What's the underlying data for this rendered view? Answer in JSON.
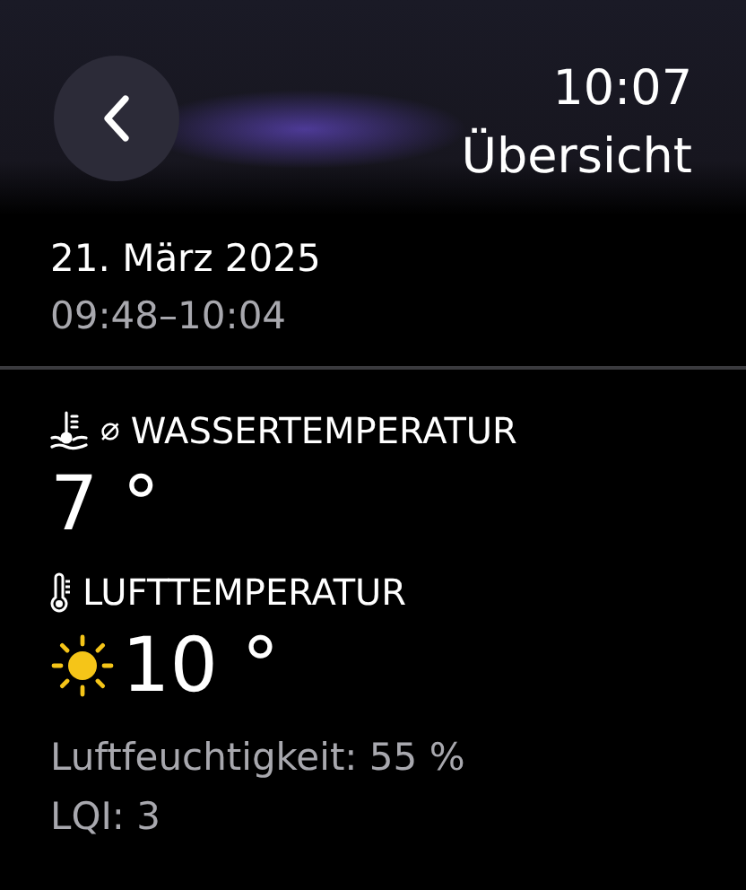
{
  "header": {
    "time": "10:07",
    "title": "Übersicht"
  },
  "session": {
    "date": "21. März 2025",
    "time_range": "09:48–10:04"
  },
  "water": {
    "symbol": "⌀",
    "label": "WASSERTEMPERATUR",
    "value": "7 °"
  },
  "air": {
    "label": "LUFTTEMPERATUR",
    "value": "10 °"
  },
  "details": [
    "Luftfeuchtigkeit: 55 %",
    "LQI: 3"
  ]
}
